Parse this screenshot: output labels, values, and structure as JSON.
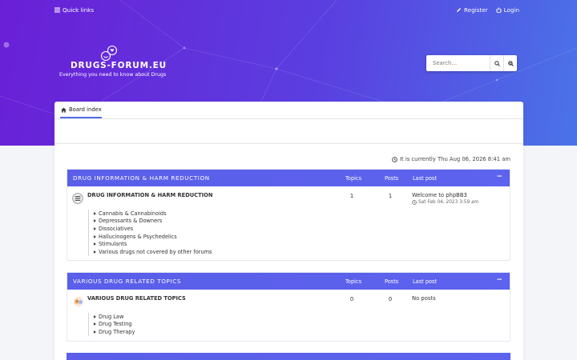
{
  "topbar": {
    "quick_links": "Quick links",
    "register": "Register",
    "login": "Login"
  },
  "brand": {
    "name": "DRUGS-FORUM.EU",
    "tagline": "Everything you need to know about Drugs"
  },
  "search": {
    "placeholder": "Search…"
  },
  "nav": {
    "board_index": "Board index"
  },
  "status": {
    "current_time": "It is currently Thu Aug 06, 2026 8:41 am"
  },
  "columns": {
    "topics": "Topics",
    "posts": "Posts",
    "last_post": "Last post"
  },
  "sections": [
    {
      "title": "DRUG INFORMATION & HARM REDUCTION",
      "toggle": "−",
      "forum": {
        "name": "DRUG INFORMATION & HARM REDUCTION",
        "topics": "1",
        "posts": "1",
        "last_post_title": "Welcome to phpBB3",
        "last_post_date": "Sat Feb 04, 2023 3:59 am",
        "subforums": [
          "Cannabis & Cannabinoids",
          "Depressants & Downers",
          "Dissociatives",
          "Hallucinogens & Psychedelics",
          "Stimulants",
          "Various drugs not covered by other forums"
        ]
      }
    },
    {
      "title": "VARIOUS DRUG RELATED TOPICS",
      "toggle": "−",
      "forum": {
        "name": "VARIOUS DRUG RELATED TOPICS",
        "topics": "0",
        "posts": "0",
        "last_post_title": "No posts",
        "subforums": [
          "Drug Law",
          "Drug Testing",
          "Drug Therapy"
        ]
      }
    }
  ],
  "colors": {
    "hero_start": "#6a1fd6",
    "hero_end": "#4a73e8",
    "section_header": "#5a5ee9",
    "tab_accent": "#4f6ee8"
  }
}
